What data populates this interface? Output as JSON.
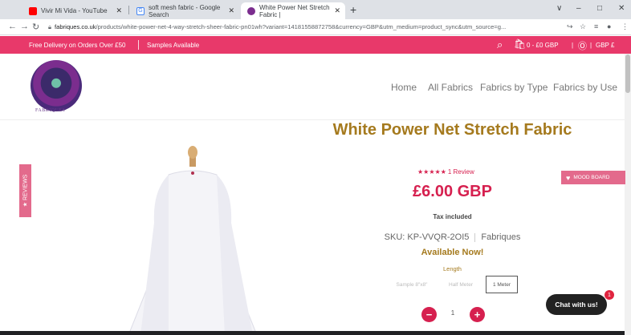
{
  "browser": {
    "tabs": [
      {
        "title": "Vivir Mi Vida - YouTube",
        "favicon_color": "#ff0000"
      },
      {
        "title": "soft mesh fabric - Google Search",
        "favicon_color": "#4285f4"
      },
      {
        "title": "White Power Net Stretch Fabric |",
        "favicon_color": "#7b2d8e"
      }
    ],
    "new_tab": "+",
    "window_controls": [
      "∨",
      "–",
      "□",
      "✕"
    ],
    "url_host": "fabriques.co.uk",
    "url_path": "/products/white-power-net-4-way-stretch-sheer-fabric-pn01wh?variant=14181558872758&currency=GBP&utm_medium=product_sync&utm_source=g..."
  },
  "promo": {
    "delivery": "Free Delivery on Orders Over £50",
    "samples": "Samples Available",
    "cart": "0 - £0 GBP",
    "currency": "GBP £"
  },
  "header": {
    "logo_text": "FABRIQUES",
    "nav": [
      "Home",
      "All Fabrics",
      "Fabrics by Type",
      "Fabrics by Use"
    ]
  },
  "reviews_tab": "★ REVIEWS",
  "product": {
    "title": "White Power Net Stretch Fabric",
    "stars": "★★★★★",
    "review_count": "1 Review",
    "price": "£6.00 GBP",
    "tax": "Tax included",
    "sku": "SKU: KP-VVQR-2OI5",
    "vendor": "Fabriques",
    "availability": "Available Now!",
    "length_label": "Length",
    "length_options": [
      "Sample 8\"x8\"",
      "Half Meter",
      "1 Meter"
    ],
    "quantity": "1"
  },
  "mood_board": "MOOD BOARD",
  "chat": {
    "label": "Chat with us!",
    "badge": "1"
  },
  "colors": {
    "brand_pink": "#e8396a",
    "price_red": "#d6204f",
    "gold": "#a57a1e"
  }
}
